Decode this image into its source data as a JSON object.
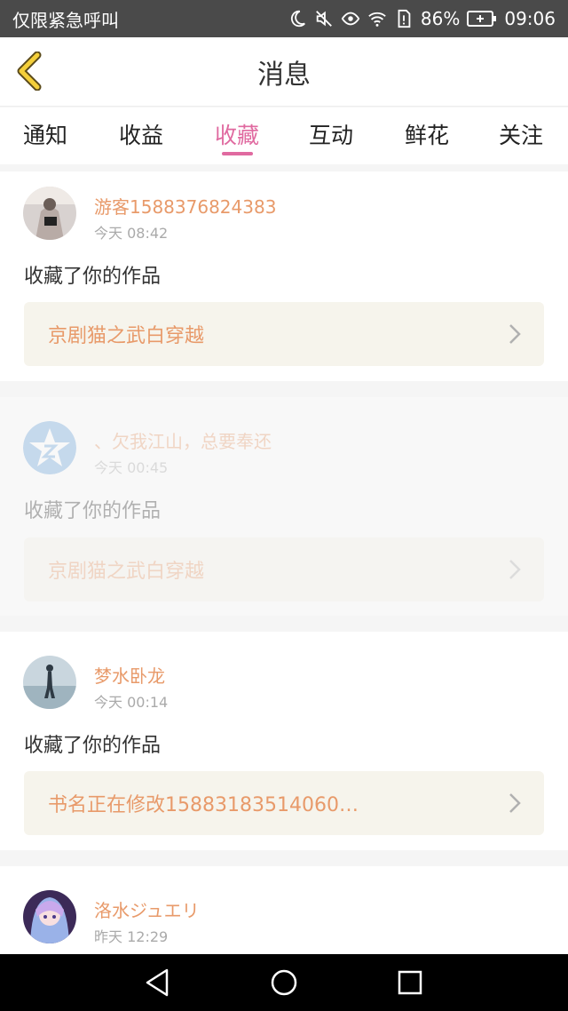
{
  "status_bar": {
    "left_text": "仅限紧急呼叫",
    "battery": "86%",
    "time": "09:06",
    "icons": [
      "moon-icon",
      "mute-icon",
      "eye-icon",
      "wifi-icon",
      "sim-icon",
      "battery-icon"
    ]
  },
  "header": {
    "title": "消息",
    "back_icon": "chevron-left-icon"
  },
  "tabs": [
    {
      "label": "通知"
    },
    {
      "label": "收益"
    },
    {
      "label": "收藏",
      "active": true
    },
    {
      "label": "互动"
    },
    {
      "label": "鲜花"
    },
    {
      "label": "关注"
    }
  ],
  "messages": [
    {
      "user": "游客1588376824383",
      "time": "今天 08:42",
      "action": "收藏了你的作品",
      "work": "京剧猫之武白穿越"
    },
    {
      "user": "、欠我江山，总要奉还",
      "time": "今天 00:45",
      "action": "收藏了你的作品",
      "work": "京剧猫之武白穿越"
    },
    {
      "user": "梦水卧龙",
      "time": "今天 00:14",
      "action": "收藏了你的作品",
      "work": "书名正在修改15883183514060…"
    },
    {
      "user": "洛水ジュエリ",
      "time": "昨天 12:29"
    }
  ],
  "colors": {
    "accent": "#e06aa0",
    "username": "#e89a6a",
    "status_bar": "#4a4a4a",
    "work_bg": "#f6f4ec"
  }
}
